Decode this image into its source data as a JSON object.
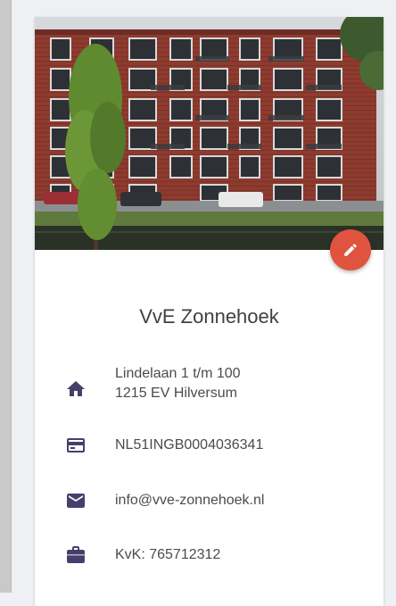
{
  "organization": {
    "name": "VvE Zonnehoek",
    "address_line1": "Lindelaan 1 t/m 100",
    "address_line2": "1215 EV Hilversum",
    "iban": "NL51INGB0004036341",
    "email": "info@vve-zonnehoek.nl",
    "kvk": "KvK: 765712312"
  },
  "icons": {
    "address": "home-icon",
    "bank": "credit-card-icon",
    "email": "mail-icon",
    "kvk": "briefcase-icon",
    "edit": "pencil-icon"
  },
  "colors": {
    "accent": "#e0533f",
    "icon": "#45406b",
    "text": "#4a4a52",
    "background": "#eef0f3"
  }
}
